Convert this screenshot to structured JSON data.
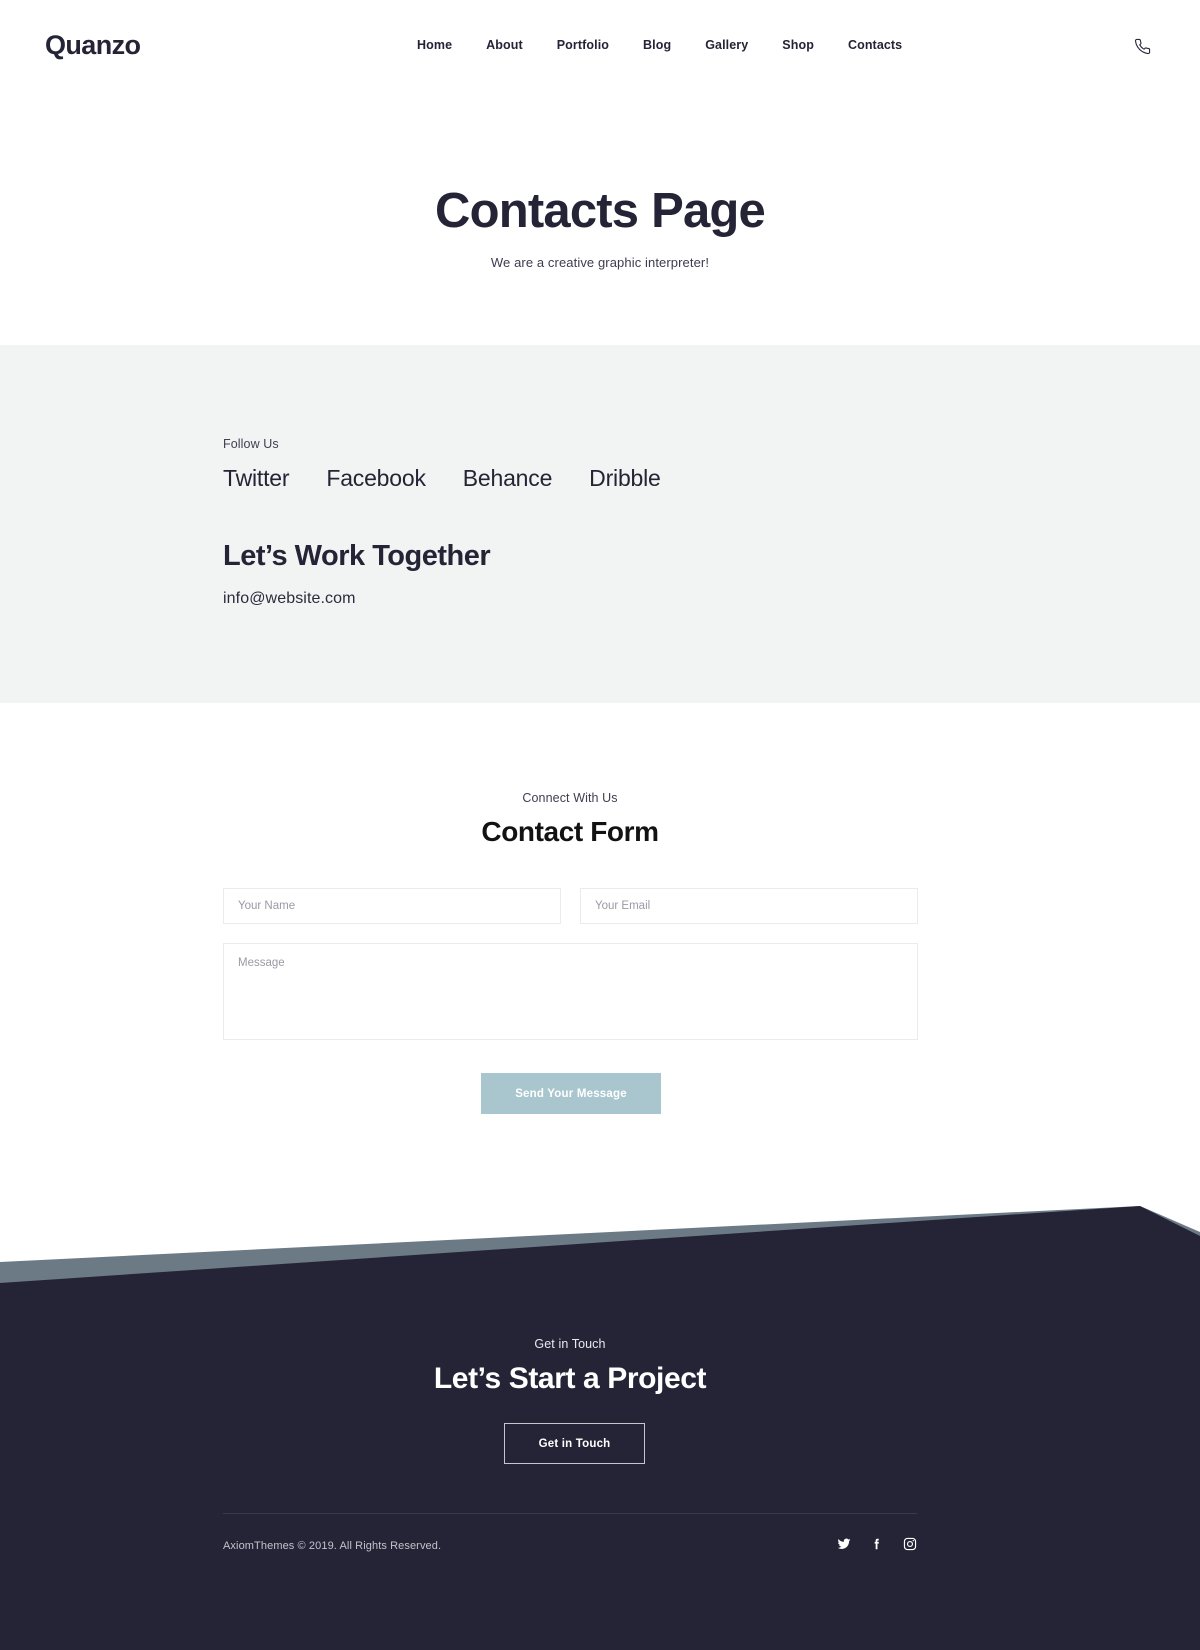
{
  "header": {
    "logo": "Quanzo",
    "nav": [
      {
        "label": "Home"
      },
      {
        "label": "About"
      },
      {
        "label": "Portfolio"
      },
      {
        "label": "Blog"
      },
      {
        "label": "Gallery"
      },
      {
        "label": "Shop"
      },
      {
        "label": "Contacts"
      }
    ],
    "phone_icon": "phone-icon"
  },
  "hero": {
    "title": "Contacts Page",
    "subtitle": "We are a creative graphic interpreter!"
  },
  "follow": {
    "label": "Follow Us",
    "links": [
      {
        "label": "Twitter"
      },
      {
        "label": "Facebook"
      },
      {
        "label": "Behance"
      },
      {
        "label": "Dribble"
      }
    ],
    "work_title": "Let’s Work Together",
    "email": "info@website.com"
  },
  "form": {
    "eyebrow": "Connect With Us",
    "title": "Contact Form",
    "name_placeholder": "Your Name",
    "name_value": "",
    "email_placeholder": "Your Email",
    "email_value": "",
    "message_placeholder": "Message",
    "message_value": "",
    "submit_label": "Send Your Message",
    "submit_color": "#a9c6cf"
  },
  "cta": {
    "eyebrow": "Get in Touch",
    "title": "Let’s Start a Project",
    "button_label": "Get in Touch",
    "background": "#242436",
    "accent": "#6b7a85"
  },
  "footer": {
    "copyright": "AxiomThemes © 2019. All Rights Reserved.",
    "socials": [
      {
        "name": "twitter-icon"
      },
      {
        "name": "facebook-icon"
      },
      {
        "name": "instagram-icon"
      }
    ]
  }
}
